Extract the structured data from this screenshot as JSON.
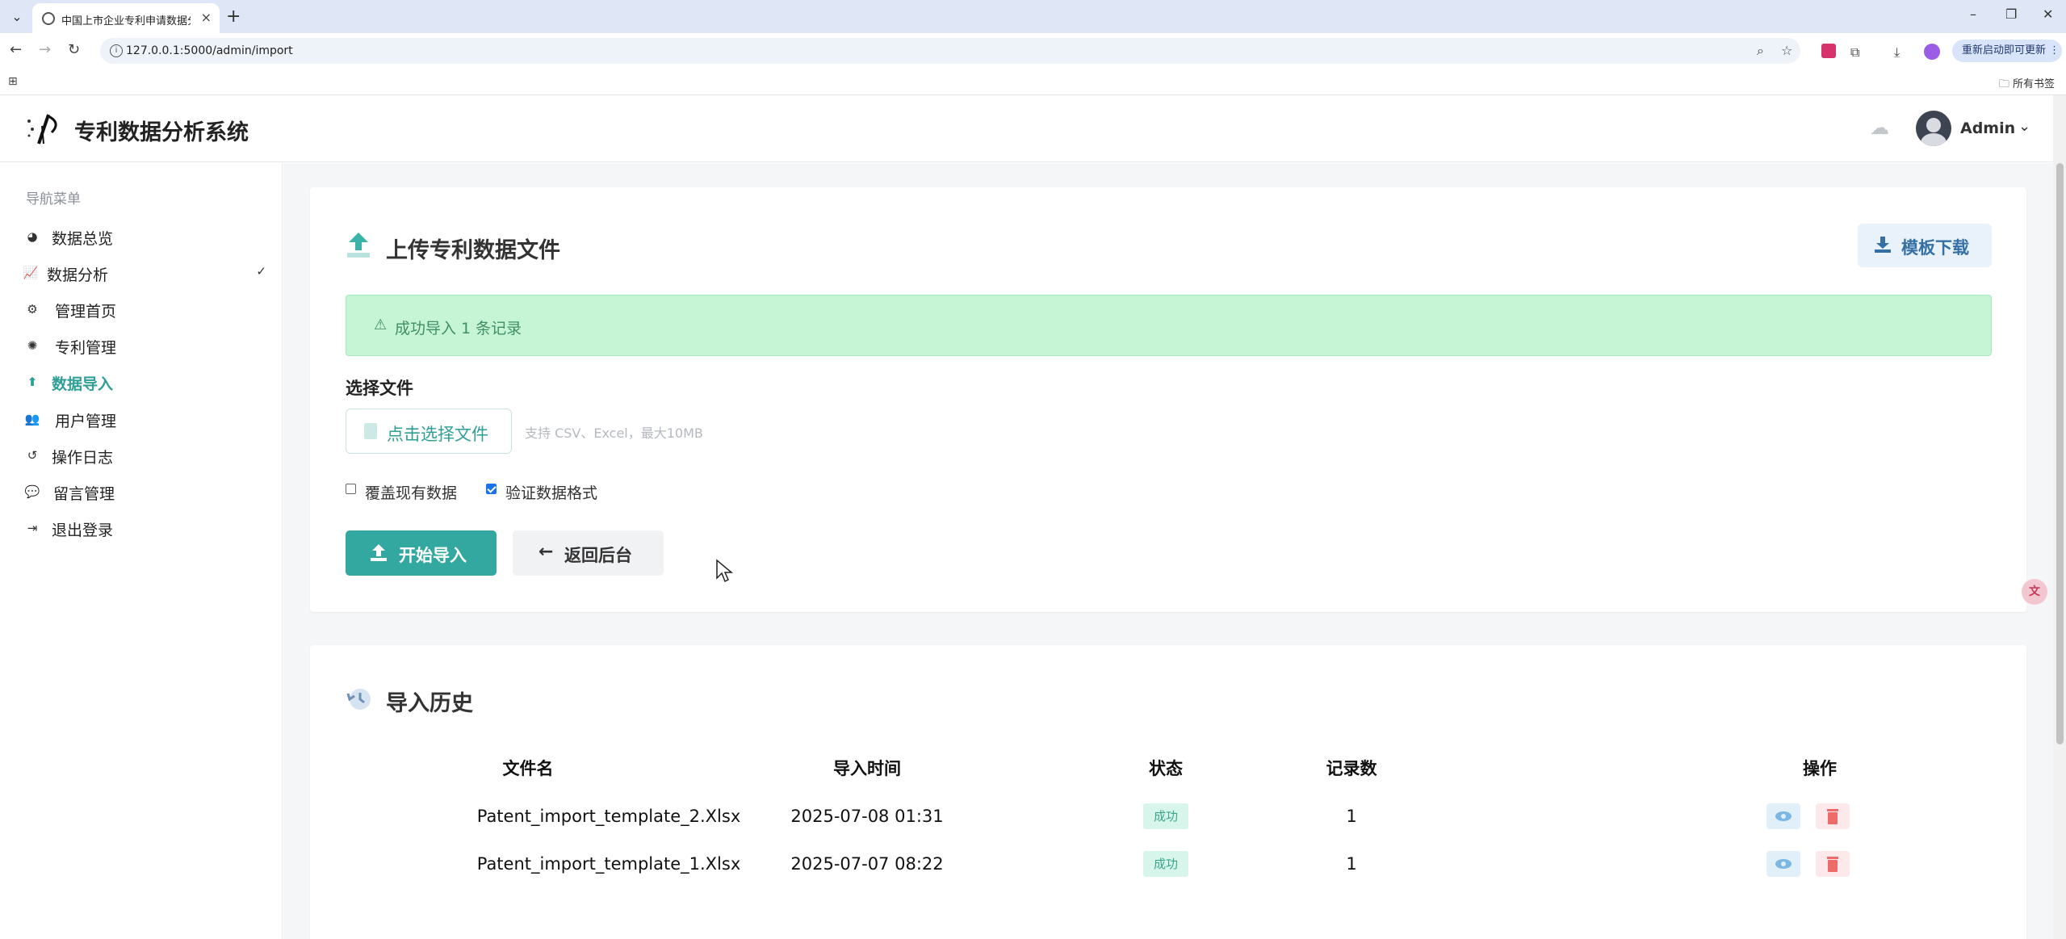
{
  "browser": {
    "tab_title": "中国上市企业专利申请数据分析",
    "url": "127.0.0.1:5000/admin/import",
    "update_label": "重新启动即可更新",
    "bookmarks_label": "所有书签"
  },
  "header": {
    "brand": "专利数据分析系统",
    "user_name": "Admin"
  },
  "sidebar": {
    "title": "导航菜单",
    "items": [
      {
        "label": "数据总览",
        "icon": "chart-pie-icon"
      },
      {
        "label": "数据分析",
        "icon": "chart-line-icon"
      },
      {
        "label": "管理首页",
        "icon": "gears-icon"
      },
      {
        "label": "专利管理",
        "icon": "lightbulb-icon"
      },
      {
        "label": "数据导入",
        "icon": "upload-icon"
      },
      {
        "label": "用户管理",
        "icon": "users-icon"
      },
      {
        "label": "操作日志",
        "icon": "history-icon"
      },
      {
        "label": "留言管理",
        "icon": "comments-icon"
      },
      {
        "label": "退出登录",
        "icon": "sign-out-icon"
      }
    ],
    "active_index": 4
  },
  "upload": {
    "title": "上传专利数据文件",
    "template_btn": "模板下载",
    "alert": "成功导入 1 条记录",
    "field_label": "选择文件",
    "file_btn": "点击选择文件",
    "file_hint": "支持 CSV、Excel，最大10MB",
    "overwrite_label": "覆盖现有数据",
    "overwrite_checked": false,
    "validate_label": "验证数据格式",
    "validate_checked": true,
    "import_btn": "开始导入",
    "back_btn": "返回后台"
  },
  "history": {
    "title": "导入历史",
    "columns": [
      "文件名",
      "导入时间",
      "状态",
      "记录数",
      "操作"
    ],
    "rows": [
      {
        "filename": "Patent_import_template_2.Xlsx",
        "time": "2025-07-08 01:31",
        "status": "成功",
        "count": "1"
      },
      {
        "filename": "Patent_import_template_1.Xlsx",
        "time": "2025-07-07 08:22",
        "status": "成功",
        "count": "1"
      }
    ]
  },
  "colors": {
    "accent": "#33a8a0",
    "success_bg": "#c6f5d6",
    "template_btn_text": "#3470a6"
  }
}
